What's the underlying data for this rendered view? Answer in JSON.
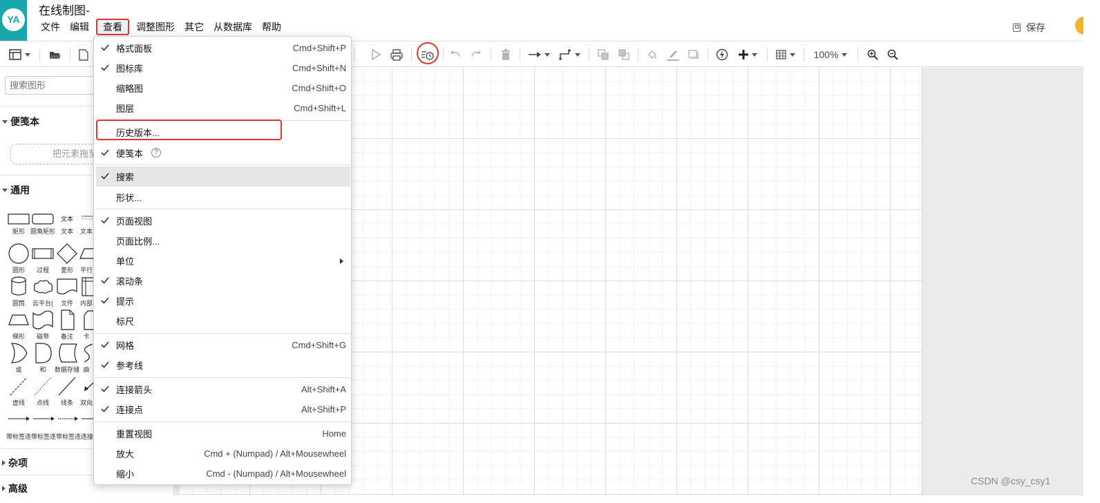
{
  "header": {
    "avatar_text": "YA",
    "doc_title": "在线制图-",
    "menus": [
      {
        "label": "文件",
        "active": false
      },
      {
        "label": "编辑",
        "active": false
      },
      {
        "label": "查看",
        "active": true
      },
      {
        "label": "调整图形",
        "active": false
      },
      {
        "label": "其它",
        "active": false
      },
      {
        "label": "从数据库",
        "active": false
      },
      {
        "label": "帮助",
        "active": false
      }
    ],
    "save_label": "保存"
  },
  "toolbar": {
    "zoom": "100%",
    "icons": [
      "panel-toggle-icon",
      "open-folder-icon",
      "new-page-icon",
      "play-icon",
      "print-icon",
      "history-icon",
      "undo-icon",
      "redo-icon",
      "delete-icon",
      "connection-style-icon",
      "waypoint-style-icon",
      "to-front-icon",
      "to-back-icon",
      "fill-color-icon",
      "line-color-icon",
      "shadow-icon",
      "edit-style-icon",
      "insert-icon",
      "table-icon",
      "zoom-in-icon",
      "zoom-out-icon"
    ]
  },
  "sidebar": {
    "search_placeholder": "搜索图形",
    "scratchpad_title": "便笺本",
    "scratchpad_drop": "把元素拖至",
    "general_title": "通用",
    "shapes": [
      {
        "label": "矩形",
        "icon": "rectangle-shape-icon"
      },
      {
        "label": "圆角矩形",
        "icon": "rounded-rectangle-shape-icon"
      },
      {
        "label": "文本",
        "icon": "text-shape-icon",
        "text": "文本"
      },
      {
        "label": "文本",
        "icon": "textbox-shape-icon"
      },
      {
        "label": "圆形",
        "icon": "ellipse-shape-icon"
      },
      {
        "label": "过程",
        "icon": "process-shape-icon"
      },
      {
        "label": "菱形",
        "icon": "rhombus-shape-icon"
      },
      {
        "label": "平行",
        "icon": "parallelogram-shape-icon"
      },
      {
        "label": "圆筒",
        "icon": "cylinder-shape-icon"
      },
      {
        "label": "云平台(",
        "icon": "cloud-shape-icon"
      },
      {
        "label": "文件",
        "icon": "document-shape-icon"
      },
      {
        "label": "内部",
        "icon": "internal-storage-shape-icon"
      },
      {
        "label": "梯形",
        "icon": "trapezoid-shape-icon"
      },
      {
        "label": "磁带",
        "icon": "tape-shape-icon"
      },
      {
        "label": "备注",
        "icon": "note-shape-icon"
      },
      {
        "label": "卡",
        "icon": "card-shape-icon"
      },
      {
        "label": "或",
        "icon": "or-shape-icon"
      },
      {
        "label": "和",
        "icon": "and-shape-icon"
      },
      {
        "label": "数据存储",
        "icon": "data-storage-shape-icon"
      },
      {
        "label": "曲",
        "icon": "curve-shape-icon"
      },
      {
        "label": "虚线",
        "icon": "dashed-line-shape-icon"
      },
      {
        "label": "点线",
        "icon": "dotted-line-shape-icon"
      },
      {
        "label": "线条",
        "icon": "line-shape-icon"
      },
      {
        "label": "双向",
        "icon": "bidirectional-arrow-shape-icon"
      }
    ],
    "footer_labels": "带标签连带标签连带标签连连接",
    "misc_title": "杂项",
    "advanced_title": "高级"
  },
  "view_menu": {
    "items": [
      {
        "label": "格式面板",
        "checked": true,
        "shortcut": "Cmd+Shift+P"
      },
      {
        "label": "图标库",
        "checked": true,
        "shortcut": "Cmd+Shift+N"
      },
      {
        "label": "缩略图",
        "checked": false,
        "shortcut": "Cmd+Shift+O"
      },
      {
        "label": "图层",
        "checked": false,
        "shortcut": "Cmd+Shift+L"
      },
      {
        "label": "历史版本...",
        "checked": false,
        "shortcut": ""
      },
      {
        "label": "便笺本",
        "checked": true,
        "shortcut": "",
        "help": "?"
      },
      {
        "label": "搜索",
        "checked": true,
        "shortcut": "",
        "highlighted": true
      },
      {
        "label": "形状...",
        "checked": false,
        "shortcut": ""
      },
      {
        "label": "页面视图",
        "checked": true,
        "shortcut": ""
      },
      {
        "label": "页面比例...",
        "checked": false,
        "shortcut": ""
      },
      {
        "label": "单位",
        "checked": false,
        "shortcut": "",
        "submenu": true
      },
      {
        "label": "滚动条",
        "checked": true,
        "shortcut": ""
      },
      {
        "label": "提示",
        "checked": true,
        "shortcut": ""
      },
      {
        "label": "标尺",
        "checked": false,
        "shortcut": ""
      },
      {
        "label": "网格",
        "checked": true,
        "shortcut": "Cmd+Shift+G"
      },
      {
        "label": "参考线",
        "checked": true,
        "shortcut": ""
      },
      {
        "label": "连接箭头",
        "checked": true,
        "shortcut": "Alt+Shift+A"
      },
      {
        "label": "连接点",
        "checked": true,
        "shortcut": "Alt+Shift+P"
      },
      {
        "label": "重置视图",
        "checked": false,
        "shortcut": "Home"
      },
      {
        "label": "放大",
        "checked": false,
        "shortcut": "Cmd + (Numpad) / Alt+Mousewheel"
      },
      {
        "label": "缩小",
        "checked": false,
        "shortcut": "Cmd - (Numpad) / Alt+Mousewheel"
      }
    ]
  },
  "watermark": "CSDN @csy_csy1",
  "colors": {
    "accent": "#19a7ae",
    "highlight": "#e0372c",
    "avatar_badge": "#f5b32a"
  }
}
